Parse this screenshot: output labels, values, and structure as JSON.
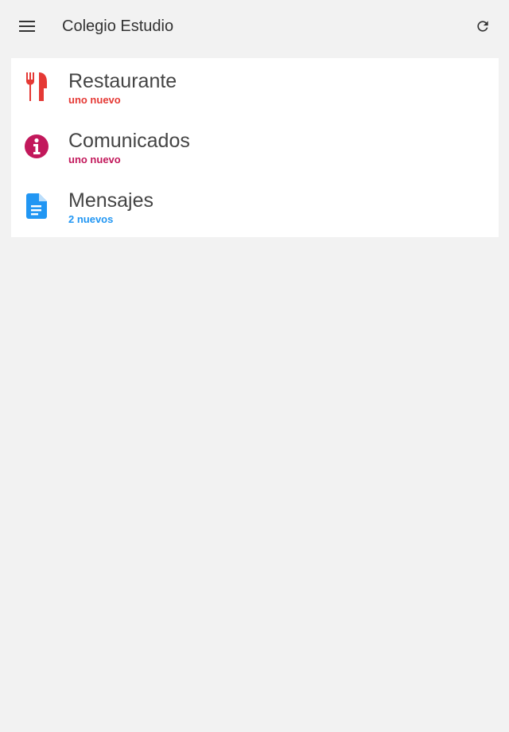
{
  "appbar": {
    "title": "Colegio Estudio",
    "menu_icon": "menu-icon",
    "refresh_icon": "refresh-icon"
  },
  "items": [
    {
      "label": "Restaurante",
      "badge": "uno nuevo",
      "icon": "restaurant-icon",
      "color": "#e53935"
    },
    {
      "label": "Comunicados",
      "badge": "uno nuevo",
      "icon": "info-icon",
      "color": "#c2185b"
    },
    {
      "label": "Mensajes",
      "badge": "2 nuevos",
      "icon": "document-icon",
      "color": "#2196f3"
    }
  ],
  "colors": {
    "background": "#f2f2f2",
    "card": "#ffffff"
  }
}
